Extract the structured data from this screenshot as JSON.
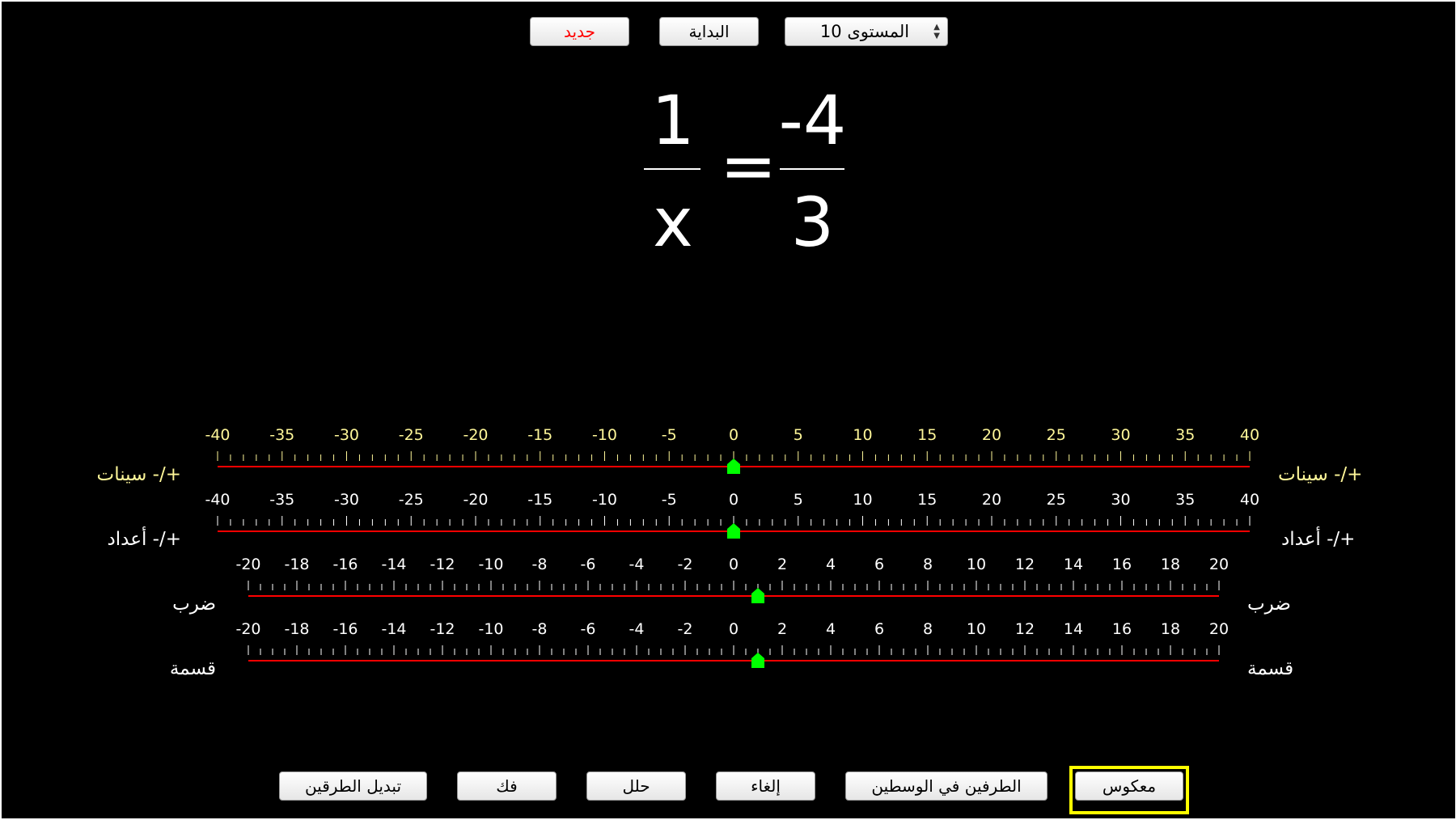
{
  "toolbar": {
    "new_label": "جديد",
    "start_label": "البداية",
    "level_value": "المستوى 10"
  },
  "equation": {
    "left_numerator": "1",
    "left_denominator": "x",
    "equals": "=",
    "right_numerator": "-4",
    "right_denominator": "3"
  },
  "sliders": [
    {
      "name": "slider-add-x",
      "label": "+/- سينات",
      "min": -40,
      "max": 40,
      "label_step": 5,
      "minor_step": 1,
      "value": 0,
      "label_color": "#fff799",
      "tick_color": "#fff799"
    },
    {
      "name": "slider-add-number",
      "label": "+/- أعداد",
      "min": -40,
      "max": 40,
      "label_step": 5,
      "minor_step": 1,
      "value": 0,
      "label_color": "#ffffff",
      "tick_color": "#ffffff"
    },
    {
      "name": "slider-multiply",
      "label": "ضرب",
      "min": -20,
      "max": 20,
      "label_step": 2,
      "minor_step": 0.5,
      "value": 1,
      "label_color": "#ffffff",
      "tick_color": "#ffffff"
    },
    {
      "name": "slider-divide",
      "label": "قسمة",
      "min": -20,
      "max": 20,
      "label_step": 2,
      "minor_step": 0.5,
      "value": 1,
      "label_color": "#ffffff",
      "tick_color": "#ffffff"
    }
  ],
  "actions": {
    "swap_sides": "تبديل الطرقين",
    "expand": "فك",
    "solve": "حلل",
    "cancel": "إلغاء",
    "cross_multiply": "الطرفين في الوسطين",
    "reciprocal": "معكوس"
  },
  "colors": {
    "background": "#000000",
    "track": "#ff0000",
    "thumb": "#00ff00",
    "focus": "#ffff00"
  }
}
